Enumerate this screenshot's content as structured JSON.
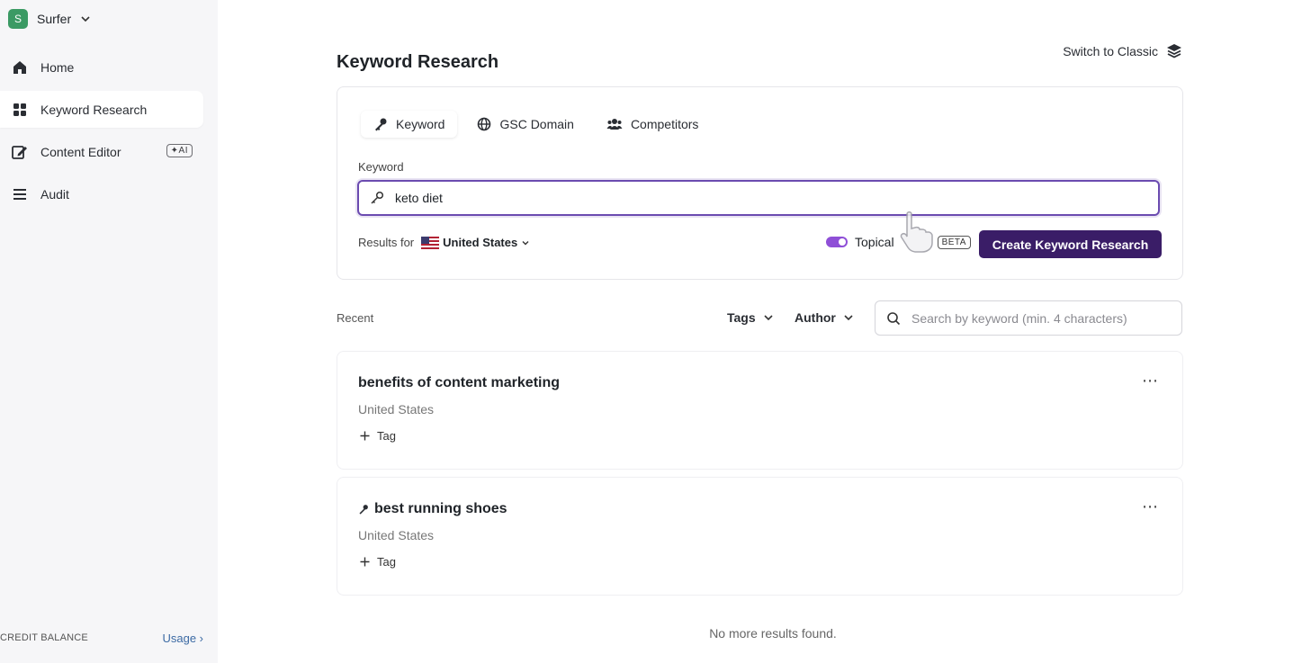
{
  "workspace": {
    "initial": "S",
    "name": "Surfer",
    "chevron": "⌄"
  },
  "sidebar": {
    "items": [
      {
        "label": "Home",
        "icon": "home-icon"
      },
      {
        "label": "Keyword Research",
        "icon": "grid-icon",
        "active": true
      },
      {
        "label": "Content Editor",
        "icon": "edit-icon",
        "badge": "✦AI"
      },
      {
        "label": "Audit",
        "icon": "list-icon"
      }
    ],
    "credit_label": "CREDIT BALANCE",
    "usage_link": "Usage ›"
  },
  "header": {
    "title": "Keyword Research",
    "switch_label": "Switch to Classic"
  },
  "search_card": {
    "tabs": [
      {
        "label": "Keyword",
        "icon": "key-icon",
        "active": true
      },
      {
        "label": "GSC Domain",
        "icon": "globe-icon"
      },
      {
        "label": "Competitors",
        "icon": "users-icon"
      }
    ],
    "keyword_label": "Keyword",
    "keyword_value": "keto diet",
    "results_for_label": "Results for",
    "country": "United States",
    "topical_label": "Topical",
    "topical_enabled": true,
    "beta_badge": "BETA",
    "create_button": "Create Keyword Research"
  },
  "recent": {
    "label": "Recent",
    "filters": {
      "tags": "Tags",
      "author": "Author"
    },
    "search_placeholder": "Search by keyword (min. 4 characters)",
    "items": [
      {
        "title": "benefits of content marketing",
        "country": "United States",
        "tag_label": "Tag",
        "has_key_icon": false
      },
      {
        "title": "best running shoes",
        "country": "United States",
        "tag_label": "Tag",
        "has_key_icon": true
      }
    ],
    "no_more": "No more results found."
  },
  "colors": {
    "accent": "#3a1d67",
    "focus_border": "#6b4bb0",
    "toggle": "#8f4fd7",
    "workspace_avatar": "#3b9a64",
    "sidebar_bg": "#f6f6f8"
  }
}
